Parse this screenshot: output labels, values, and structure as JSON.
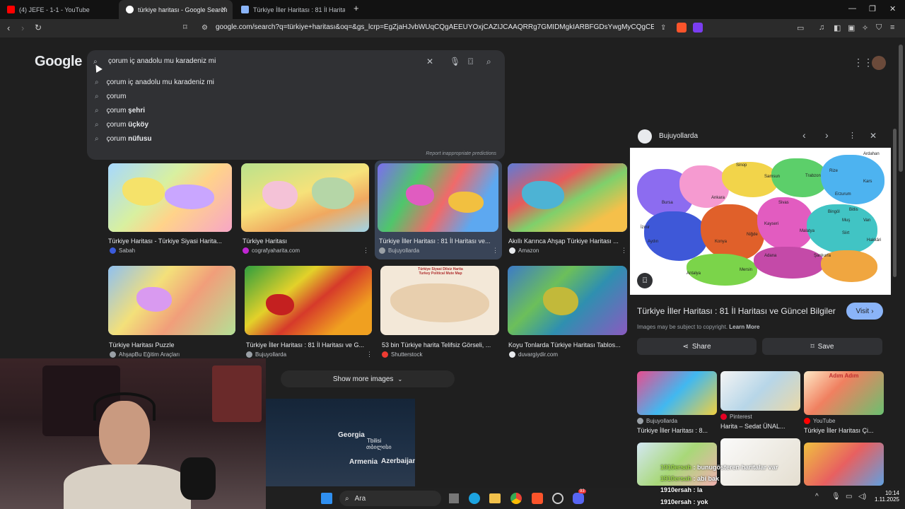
{
  "tabs": [
    {
      "title": "(4) JEFE - 1-1 - YouTube",
      "fav": "#ff0000"
    },
    {
      "title": "türkiye haritası - Google Search",
      "fav": "#ffffff"
    },
    {
      "title": "Türkiye İller Haritası : 81 İl Haritası ve",
      "fav": "#8ab4f8"
    }
  ],
  "url": "google.com/search?q=türkiye+haritası&oq=&gs_lcrp=EgZjaHJvbWUqCQgAEEUYOxjCAZIJCAAQRRg7GMIDMgkIARBFGDsYwgMyCQgCEEUYOxjCAzIJ...",
  "google_logo": "Google",
  "search": {
    "query": "çorum iç anadolu mu karadeniz mi",
    "suggestions": [
      {
        "pre": "çorum iç anadolu mu karadeniz mi",
        "bold": ""
      },
      {
        "pre": "çorum",
        "bold": ""
      },
      {
        "pre": "çorum ",
        "bold": "şehri"
      },
      {
        "pre": "çorum ",
        "bold": "üçköy"
      },
      {
        "pre": "çorum ",
        "bold": "nüfusu"
      }
    ],
    "report": "Report inappropriate predictions"
  },
  "row1": [
    {
      "title": "Türkiye Haritası - Türkiye Siyasi Harita...",
      "source": "Sabah",
      "dot": "#3b5bdb"
    },
    {
      "title": "Türkiye Haritası",
      "source": "cografyaharita.com",
      "dot": "#c026d3"
    },
    {
      "title": "Türkiye İller Haritası : 81 İl Haritası ve...",
      "source": "Bujuyollarda",
      "dot": "#9aa0a6"
    },
    {
      "title": "Akıllı Karınca Ahşap Türkiye Haritası ...",
      "source": "Amazon",
      "dot": "#e8eaed"
    }
  ],
  "row2": [
    {
      "title": "Türkiye Haritası Puzzle",
      "source": "AhşapBu Eğitim Araçları",
      "dot": "#9aa0a6"
    },
    {
      "title": "Türkiye İller Haritası : 81 İl Haritası ve G...",
      "source": "Bujuyollarda",
      "dot": "#9aa0a6"
    },
    {
      "title": "53 bin Türkiye harita Telifsiz Görseli, ...",
      "source": "Shutterstock",
      "dot": "#ee3b32"
    },
    {
      "title": "Koyu Tonlarda Türkiye Haritası Tablos...",
      "source": "duvargiydir.com",
      "dot": "#e8eaed"
    }
  ],
  "thumb3_caption": "Türkiye Siyasi Dilsiz Harita\nTurkey Political Mute Map",
  "show_more": "Show more images",
  "mini_map": {
    "labels": [
      "Georgia",
      "Tbilisi",
      "თბილისი",
      "Armenia",
      "Azerbaijan"
    ]
  },
  "panel": {
    "source": "Bujuyollarda",
    "title": "Türkiye İller Haritası : 81 İl Haritası ve Güncel Bilgiler",
    "visit": "Visit",
    "copyright": "Images may be subject to copyright.",
    "learn_more": "Learn More",
    "share": "Share",
    "save": "Save",
    "related": [
      {
        "source": "Bujuyollarda",
        "title": "Türkiye İller Haritası : 8..."
      },
      {
        "source": "Pinterest",
        "title": "Harita – Sedat ÜNAL..."
      },
      {
        "source": "YouTube",
        "title": "Türkiye İller Haritası Çi..."
      }
    ],
    "map_cities": [
      "Ardahan",
      "Kars",
      "Sinop",
      "Samsun",
      "Rize",
      "Trabzon",
      "Sivas",
      "Ankara",
      "Konya",
      "Erzurum",
      "Van",
      "Malatya",
      "Antalya",
      "Adana",
      "Mersin",
      "Şanlıurfa",
      "Bursa",
      "İzmir",
      "Aydın",
      "Kayseri",
      "Niğde",
      "Bitlis",
      "Siirt",
      "Hakkâri",
      "Bingöl",
      "Muş"
    ],
    "related3_title": "Adım Adım"
  },
  "chat": [
    {
      "user": "1910ersah",
      "msg": "bunugösteren haritalar var"
    },
    {
      "user": "1910ersah",
      "msg": "abi bak"
    },
    {
      "user": "1910ersah",
      "msg": "la"
    },
    {
      "user": "1910ersah",
      "msg": "yok"
    }
  ],
  "taskbar": {
    "search": "Ara",
    "time": "10:14",
    "date": "1.11.2025",
    "discord_badge": "93"
  }
}
